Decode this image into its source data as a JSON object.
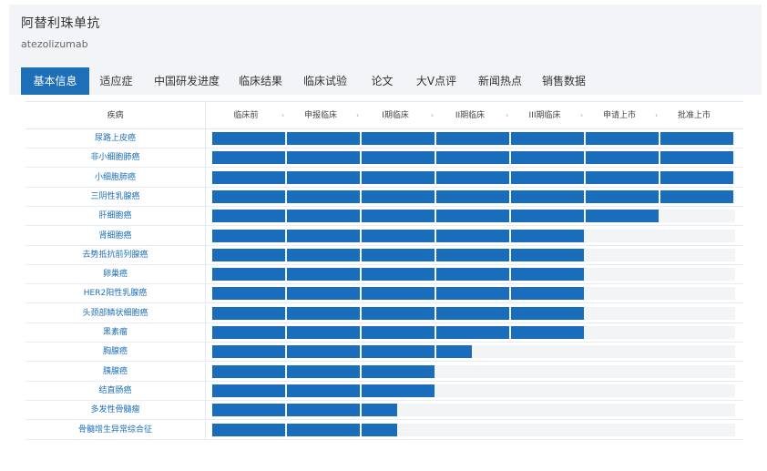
{
  "drug": {
    "name_cn": "阿替利珠单抗",
    "name_en": "atezolizumab"
  },
  "tabs": [
    {
      "label": "基本信息",
      "active": true
    },
    {
      "label": "适应症",
      "active": false
    },
    {
      "label": "中国研发进度",
      "active": false
    },
    {
      "label": "临床结果",
      "active": false
    },
    {
      "label": "临床试验",
      "active": false
    },
    {
      "label": "论文",
      "active": false
    },
    {
      "label": "大V点评",
      "active": false
    },
    {
      "label": "新闻热点",
      "active": false
    },
    {
      "label": "销售数据",
      "active": false
    }
  ],
  "table": {
    "disease_header": "疾病",
    "phases": [
      "临床前",
      "申报临床",
      "I期临床",
      "II期临床",
      "III期临床",
      "申请上市",
      "批准上市"
    ],
    "separator": "›",
    "rows": [
      {
        "name": "尿路上皮癌",
        "progress": 7
      },
      {
        "name": "非小细胞肺癌",
        "progress": 7
      },
      {
        "name": "小细胞肺癌",
        "progress": 7
      },
      {
        "name": "三阴性乳腺癌",
        "progress": 7
      },
      {
        "name": "肝细胞癌",
        "progress": 6
      },
      {
        "name": "肾细胞癌",
        "progress": 5
      },
      {
        "name": "去势抵抗前列腺癌",
        "progress": 5
      },
      {
        "name": "卵巢癌",
        "progress": 5
      },
      {
        "name": "HER2阳性乳腺癌",
        "progress": 5
      },
      {
        "name": "头颈部鳞状细胞癌",
        "progress": 5
      },
      {
        "name": "黑素瘤",
        "progress": 5
      },
      {
        "name": "胸腺癌",
        "progress": 3.5
      },
      {
        "name": "胰腺癌",
        "progress": 3
      },
      {
        "name": "结直肠癌",
        "progress": 3
      },
      {
        "name": "多发性骨髓瘤",
        "progress": 2.5
      },
      {
        "name": "骨髓增生异常综合征",
        "progress": 2.5
      }
    ]
  },
  "colors": {
    "accent": "#1d6fb8",
    "bar": "#1a6dba",
    "track": "#f3f4f6"
  }
}
